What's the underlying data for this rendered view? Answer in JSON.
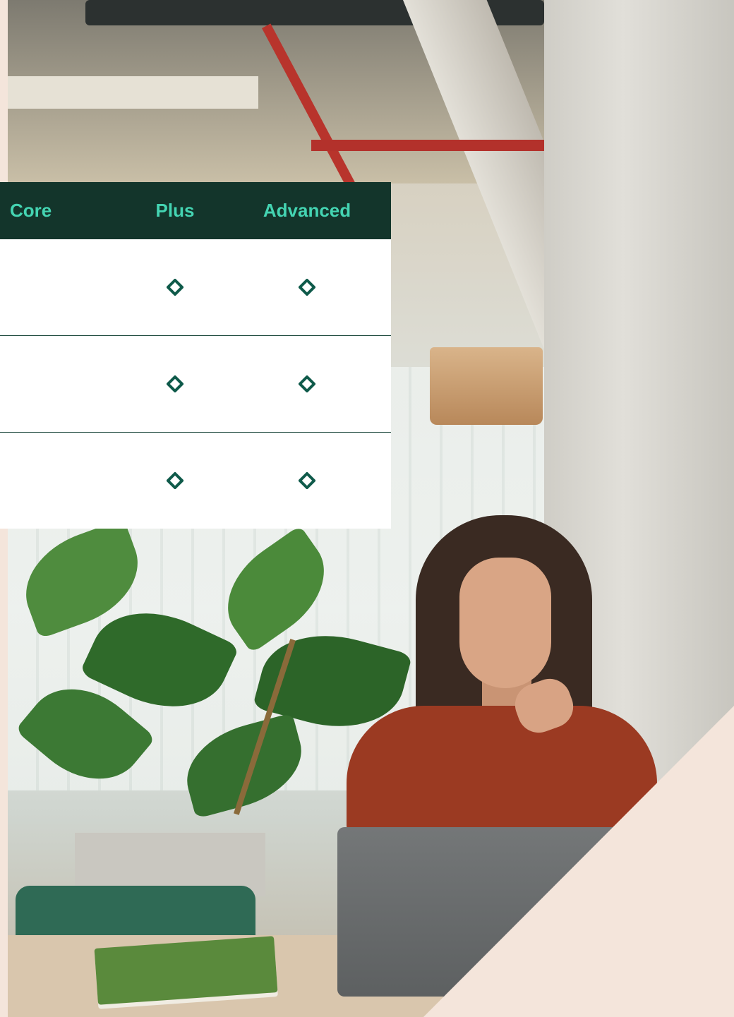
{
  "plans": {
    "core": "Core",
    "plus": "Plus",
    "advanced": "Advanced"
  },
  "rows": [
    {
      "core": false,
      "plus": true,
      "advanced": true
    },
    {
      "core": false,
      "plus": true,
      "advanced": true
    },
    {
      "core": false,
      "plus": true,
      "advanced": true
    }
  ],
  "colors": {
    "header_bg": "#13352b",
    "header_text": "#44d4b2",
    "check": "#0f5a4a",
    "accent_bg": "#f4e5db"
  },
  "icons": {
    "included": "diamond-check-icon"
  }
}
